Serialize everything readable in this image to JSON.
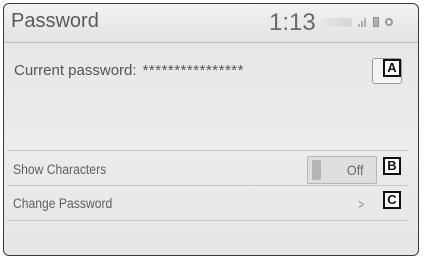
{
  "header": {
    "title": "Password",
    "clock": "1:13"
  },
  "status_icons": [
    "signal-icon",
    "battery-icon",
    "gear-icon"
  ],
  "current_password": {
    "label": "Current password:",
    "value": "****************"
  },
  "rows": [
    {
      "label": "Show Characters",
      "toggle_value": "Off"
    },
    {
      "label": "Change Password",
      "chevron": ">"
    }
  ],
  "callouts": [
    "A",
    "B",
    "C"
  ]
}
